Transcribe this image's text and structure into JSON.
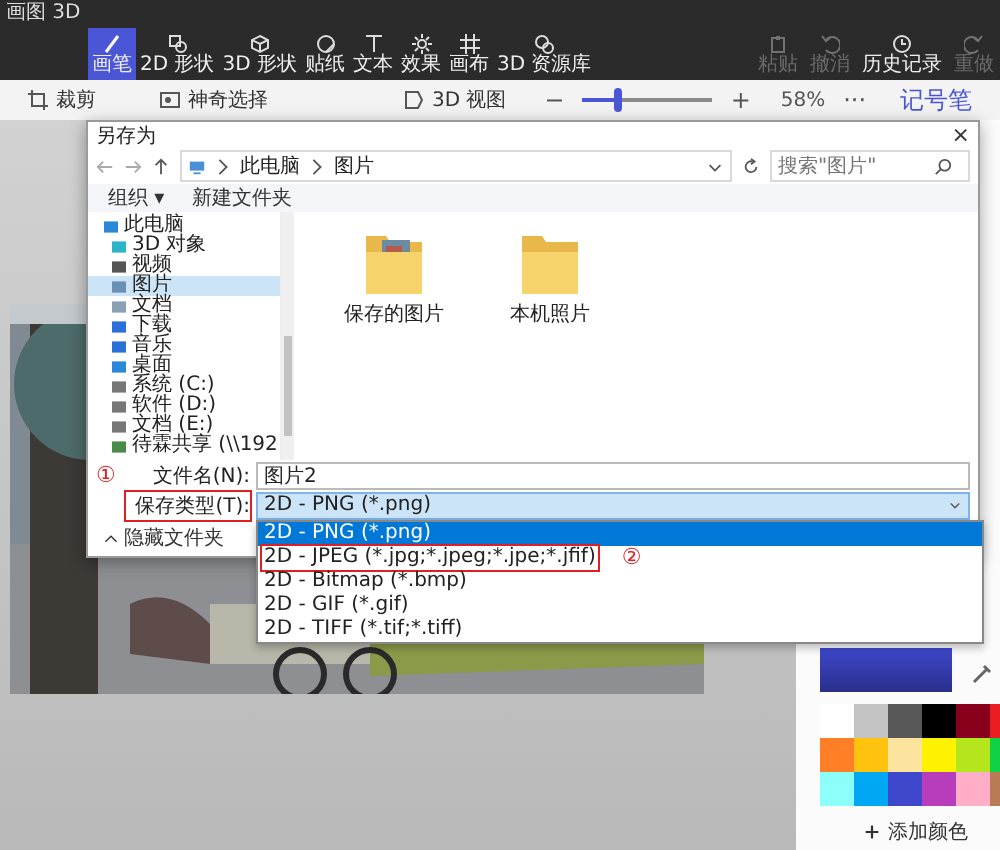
{
  "app": {
    "title": "画图 3D"
  },
  "tools": [
    {
      "label": "画笔",
      "selected": true
    },
    {
      "label": "2D 形状",
      "selected": false
    },
    {
      "label": "3D 形状",
      "selected": false
    },
    {
      "label": "贴纸",
      "selected": false
    },
    {
      "label": "文本",
      "selected": false
    },
    {
      "label": "效果",
      "selected": false
    },
    {
      "label": "画布",
      "selected": false
    },
    {
      "label": "3D 资源库",
      "selected": false
    }
  ],
  "actions": [
    {
      "label": "粘贴",
      "disabled": true
    },
    {
      "label": "撤消",
      "disabled": true
    },
    {
      "label": "历史记录",
      "disabled": false
    },
    {
      "label": "重做",
      "disabled": true
    }
  ],
  "subbar": {
    "crop": "裁剪",
    "magic_select": "神奇选择",
    "view_3d": "3D 视图",
    "zoom_out": "−",
    "zoom": {
      "level": 0.27
    },
    "zoom_in": "+",
    "zoom_value": "58%",
    "more": "···"
  },
  "panel": {
    "title": "记号笔",
    "add_color": "添加颜色",
    "swatches": [
      {
        "color": "#ffffff"
      },
      {
        "color": "#c3c3c3"
      },
      {
        "color": "#585858"
      },
      {
        "color": "#000000"
      },
      {
        "color": "#88001b"
      },
      {
        "color": "#ec1c24"
      },
      {
        "color": "#ff7f27"
      },
      {
        "color": "#ffc20e"
      },
      {
        "color": "#fde49e"
      },
      {
        "color": "#fff200"
      },
      {
        "color": "#b5e61d"
      },
      {
        "color": "#0ed145"
      },
      {
        "color": "#8cfffb"
      },
      {
        "color": "#00a8f3"
      },
      {
        "color": "#3f48cc"
      },
      {
        "color": "#b83dba"
      },
      {
        "color": "#ffaec8"
      },
      {
        "color": "#b97a56"
      }
    ]
  },
  "dialog": {
    "title": "另存为",
    "close": "×",
    "path": [
      "此电脑",
      "图片"
    ],
    "search": {
      "placeholder": "搜索\"图片\""
    },
    "commands": [
      "组织 ▾",
      "新建文件夹"
    ],
    "tree": [
      {
        "label": "此电脑",
        "selected": false,
        "children": [
          {
            "label": "3D 对象",
            "selected": false
          },
          {
            "label": "视频",
            "selected": false
          },
          {
            "label": "图片",
            "selected": true
          },
          {
            "label": "文档",
            "selected": false
          },
          {
            "label": "下载",
            "selected": false
          },
          {
            "label": "音乐",
            "selected": false
          },
          {
            "label": "桌面",
            "selected": false
          },
          {
            "label": "系统 (C:)",
            "selected": false
          },
          {
            "label": "软件 (D:)",
            "selected": false
          },
          {
            "label": "文档 (E:)",
            "selected": false
          },
          {
            "label": "待霖共享 (\\\\192",
            "selected": false
          }
        ]
      }
    ],
    "items": [
      {
        "label": "保存的图片",
        "kind": "photos"
      },
      {
        "label": "本机照片",
        "kind": "plain"
      }
    ],
    "file_name": {
      "label": "文件名(N):",
      "value": "图片2"
    },
    "file_type": {
      "label": "保存类型(T):",
      "value": "2D - PNG (*.png)",
      "highlighted": true
    },
    "options": [
      {
        "label": "2D - PNG (*.png)",
        "selected": true,
        "highlighted": false
      },
      {
        "label": "2D - JPEG (*.jpg;*.jpeg;*.jpe;*.jfif)",
        "selected": false,
        "highlighted": true
      },
      {
        "label": "2D - Bitmap (*.bmp)",
        "selected": false,
        "highlighted": false
      },
      {
        "label": "2D - GIF (*.gif)",
        "selected": false,
        "highlighted": false
      },
      {
        "label": "2D - TIFF (*.tif;*.tiff)",
        "selected": false,
        "highlighted": false
      }
    ],
    "hide_folders": "隐藏文件夹",
    "annotations": [
      "①",
      "②"
    ]
  }
}
